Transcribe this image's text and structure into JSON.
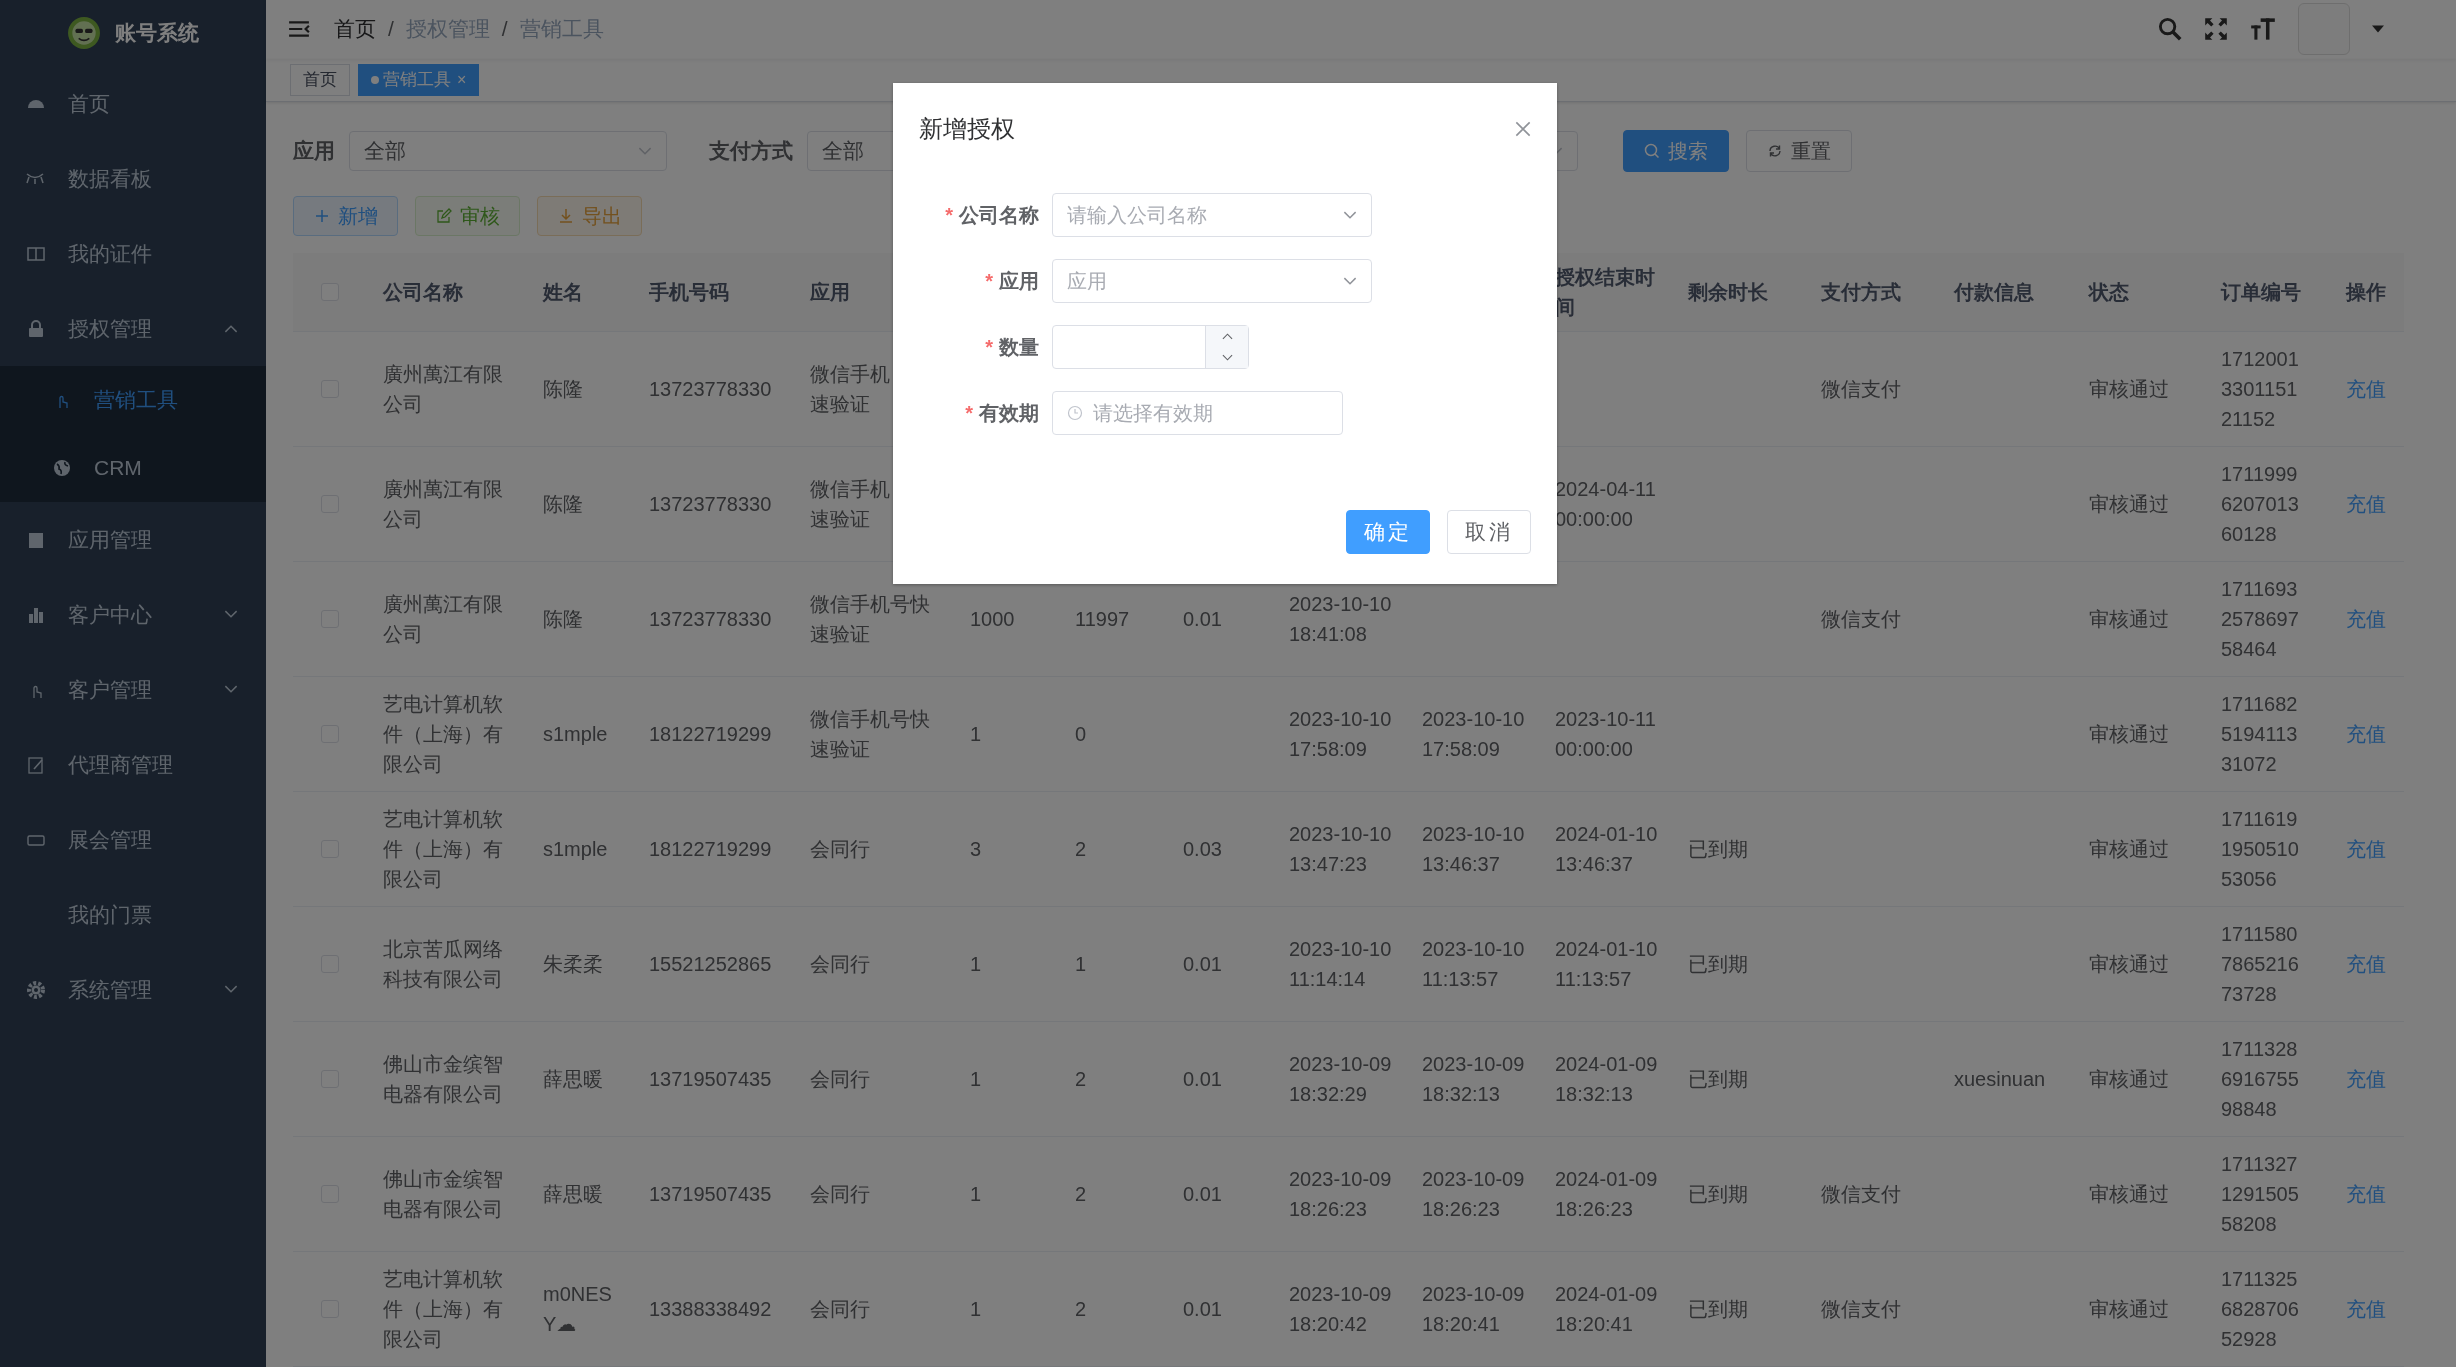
{
  "sidebar": {
    "title": "账号系统",
    "items": [
      {
        "label": "首页",
        "selected": false
      },
      {
        "label": "数据看板",
        "selected": false
      },
      {
        "label": "我的证件",
        "selected": false
      },
      {
        "label": "授权管理",
        "selected": false,
        "expanded": true,
        "children": [
          {
            "label": "营销工具",
            "selected": true
          },
          {
            "label": "CRM",
            "selected": false
          }
        ]
      },
      {
        "label": "应用管理",
        "selected": false
      },
      {
        "label": "客户中心",
        "selected": false,
        "expanded": false
      },
      {
        "label": "客户管理",
        "selected": false,
        "expanded": false
      },
      {
        "label": "代理商管理",
        "selected": false
      },
      {
        "label": "展会管理",
        "selected": false
      },
      {
        "label": "我的门票",
        "selected": false
      },
      {
        "label": "系统管理",
        "selected": false,
        "expanded": false
      }
    ]
  },
  "breadcrumb": {
    "separator": "/",
    "items": [
      "首页",
      "授权管理",
      "营销工具"
    ]
  },
  "tabs": [
    {
      "label": "首页",
      "selected": false
    },
    {
      "label": "营销工具",
      "selected": true,
      "close": "×"
    }
  ],
  "filters": [
    {
      "label": "应用",
      "value": "全部"
    },
    {
      "label": "支付方式",
      "value": "全部"
    }
  ],
  "filter_buttons": [
    {
      "label": "搜索",
      "kind": "search"
    },
    {
      "label": "重置",
      "kind": "reset"
    }
  ],
  "toolbar": [
    {
      "label": "新增",
      "kind": "add",
      "disabled": false
    },
    {
      "label": "审核",
      "kind": "edit",
      "disabled": true
    },
    {
      "label": "导出",
      "kind": "export",
      "disabled": false
    }
  ],
  "table": {
    "header_checked": false,
    "columns": [
      {
        "label": "公司名称",
        "kind": "text"
      },
      {
        "label": "姓名",
        "kind": "name"
      },
      {
        "label": "手机号码",
        "kind": "text"
      },
      {
        "label": "应用",
        "kind": "text"
      },
      {
        "kind": "text"
      },
      {
        "kind": "text"
      },
      {
        "kind": "text"
      },
      {
        "kind": "text"
      },
      {
        "kind": "text"
      },
      {
        "label": "授权结束时间",
        "kind": "text"
      },
      {
        "label": "剩余时长",
        "kind": "text"
      },
      {
        "label": "支付方式",
        "kind": "text"
      },
      {
        "label": "付款信息",
        "kind": "text"
      },
      {
        "label": "状态",
        "kind": "text"
      },
      {
        "label": "订单编号",
        "kind": "order"
      },
      {
        "label": "操作",
        "kind": "link"
      }
    ],
    "rows": [
      {
        "checked": false,
        "cells": [
          "廣州萬江有限公司",
          "陈隆",
          "13723778330",
          [
            "微信手机",
            "速验证"
          ],
          null,
          null,
          null,
          null,
          null,
          null,
          null,
          "微信支付",
          null,
          "审核通过",
          "1712001330115121152",
          "充值"
        ]
      },
      {
        "checked": false,
        "cells": [
          "廣州萬江有限公司",
          "陈隆",
          "13723778330",
          [
            "微信手机",
            "速验证"
          ],
          null,
          null,
          null,
          null,
          null,
          "2024-04-11 00:00:00",
          null,
          null,
          null,
          "审核通过",
          "1711999620701360128",
          "充值"
        ]
      },
      {
        "checked": false,
        "cells": [
          "廣州萬江有限公司",
          "陈隆",
          "13723778330",
          "微信手机号快速验证",
          "1000",
          "11997",
          "0.01",
          "2023-10-10 18:41:08",
          null,
          null,
          null,
          "微信支付",
          null,
          "审核通过",
          "1711693257869758464",
          "充值"
        ]
      },
      {
        "checked": false,
        "cells": [
          "艺电计算机软件（上海）有限公司",
          "s1mple",
          "18122719299",
          "微信手机号快速验证",
          "1",
          "0",
          null,
          "2023-10-10 17:58:09",
          "2023-10-10 17:58:09",
          "2023-10-11 00:00:00",
          null,
          null,
          null,
          "审核通过",
          "1711682519411331072",
          "充值"
        ]
      },
      {
        "checked": false,
        "cells": [
          "艺电计算机软件（上海）有限公司",
          "s1mple",
          "18122719299",
          "会同行",
          "3",
          "2",
          "0.03",
          "2023-10-10 13:47:23",
          "2023-10-10 13:46:37",
          "2024-01-10 13:46:37",
          "已到期",
          null,
          null,
          "审核通过",
          "1711619195051053056",
          "充值"
        ]
      },
      {
        "checked": false,
        "cells": [
          "北京苦瓜网络科技有限公司",
          "朱柔柔",
          "15521252865",
          "会同行",
          "1",
          "1",
          "0.01",
          "2023-10-10 11:14:14",
          "2023-10-10 11:13:57",
          "2024-01-10 11:13:57",
          "已到期",
          null,
          null,
          "审核通过",
          "1711580786521673728",
          "充值"
        ]
      },
      {
        "checked": false,
        "cells": [
          "佛山市金缤智电器有限公司",
          "薛思暖",
          "13719507435",
          "会同行",
          "1",
          "2",
          "0.01",
          "2023-10-09 18:32:29",
          "2023-10-09 18:32:13",
          "2024-01-09 18:32:13",
          "已到期",
          null,
          "xuesinuan",
          "审核通过",
          "1711328691675598848",
          "充值"
        ]
      },
      {
        "checked": false,
        "cells": [
          "佛山市金缤智电器有限公司",
          "薛思暖",
          "13719507435",
          "会同行",
          "1",
          "2",
          "0.01",
          "2023-10-09 18:26:23",
          "2023-10-09 18:26:23",
          "2024-01-09 18:26:23",
          "已到期",
          "微信支付",
          null,
          "审核通过",
          "1711327129150558208",
          "充值"
        ]
      },
      {
        "checked": false,
        "cells": [
          "艺电计算机软件（上海）有限公司",
          "m0NESY☁",
          "13388338492",
          "会同行",
          "1",
          "2",
          "0.01",
          "2023-10-09 18:20:42",
          "2023-10-09 18:20:41",
          "2024-01-09 18:20:41",
          "已到期",
          "微信支付",
          null,
          "审核通过",
          "1711325682870652928",
          "充值"
        ]
      }
    ]
  },
  "dialog": {
    "title": "新增授权",
    "required_mark": "*",
    "fields": [
      {
        "label": "公司名称",
        "kind": "select",
        "required": true,
        "placeholder": "请输入公司名称"
      },
      {
        "label": "应用",
        "kind": "select",
        "required": true,
        "placeholder": "应用"
      },
      {
        "label": "数量",
        "kind": "number",
        "required": true
      },
      {
        "label": "有效期",
        "kind": "date",
        "required": true,
        "placeholder": "请选择有效期"
      }
    ],
    "buttons": [
      {
        "label": "确定",
        "kind": "primary"
      },
      {
        "label": "取消",
        "kind": "default"
      }
    ]
  }
}
